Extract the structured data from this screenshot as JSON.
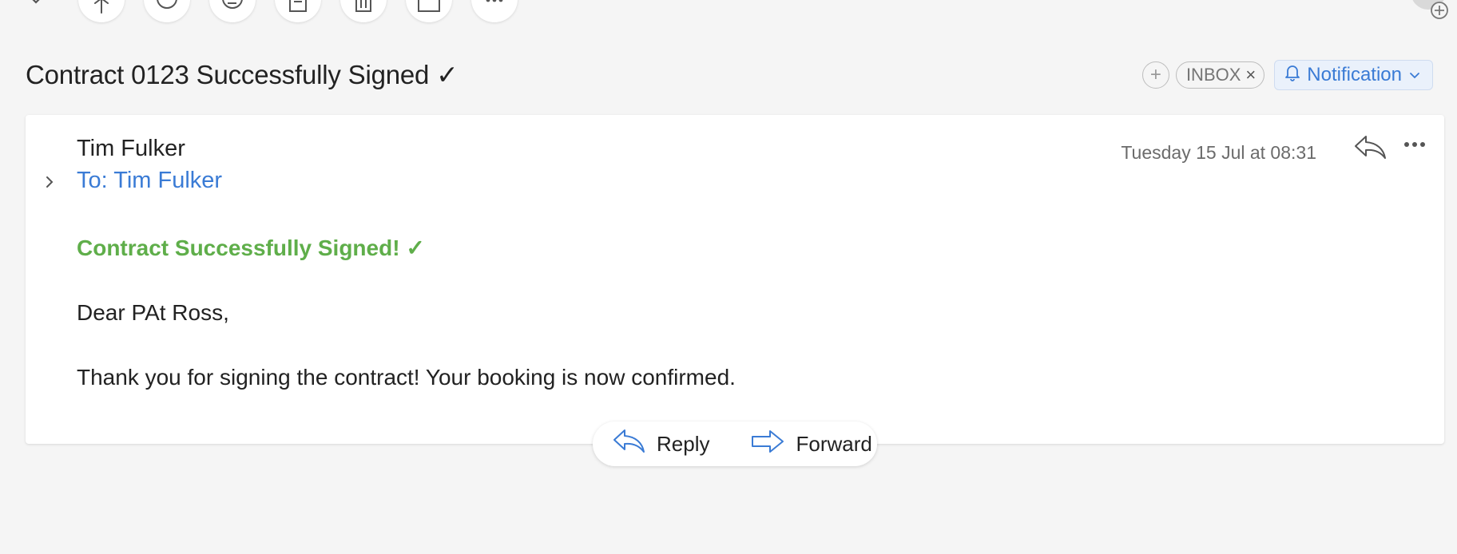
{
  "toolbar": {
    "icons": [
      "close-icon",
      "pin-icon",
      "mark-unread-icon",
      "snooze-icon",
      "archive-icon",
      "trash-icon",
      "move-icon",
      "more-icon",
      "add-contact-icon"
    ]
  },
  "message": {
    "subject": "Contract 0123 Successfully Signed ✓",
    "tags": {
      "inbox_label": "INBOX",
      "inbox_remove": "×",
      "category_label": "Notification"
    },
    "sender": "Tim Fulker",
    "recipient": "To: Tim Fulker",
    "date": "Tuesday 15 Jul at 08:31",
    "body": {
      "heading": "Contract Successfully Signed! ✓",
      "greeting": "Dear PAt Ross,",
      "text": "Thank you for signing the contract! Your booking is now confirmed."
    }
  },
  "actions": {
    "reply_label": "Reply",
    "forward_label": "Forward"
  },
  "colors": {
    "background": "#f5f5f5",
    "accent_blue": "#3a7bd5",
    "heading_green": "#5fae4a",
    "tag_notification_bg": "#eaf1fb"
  }
}
